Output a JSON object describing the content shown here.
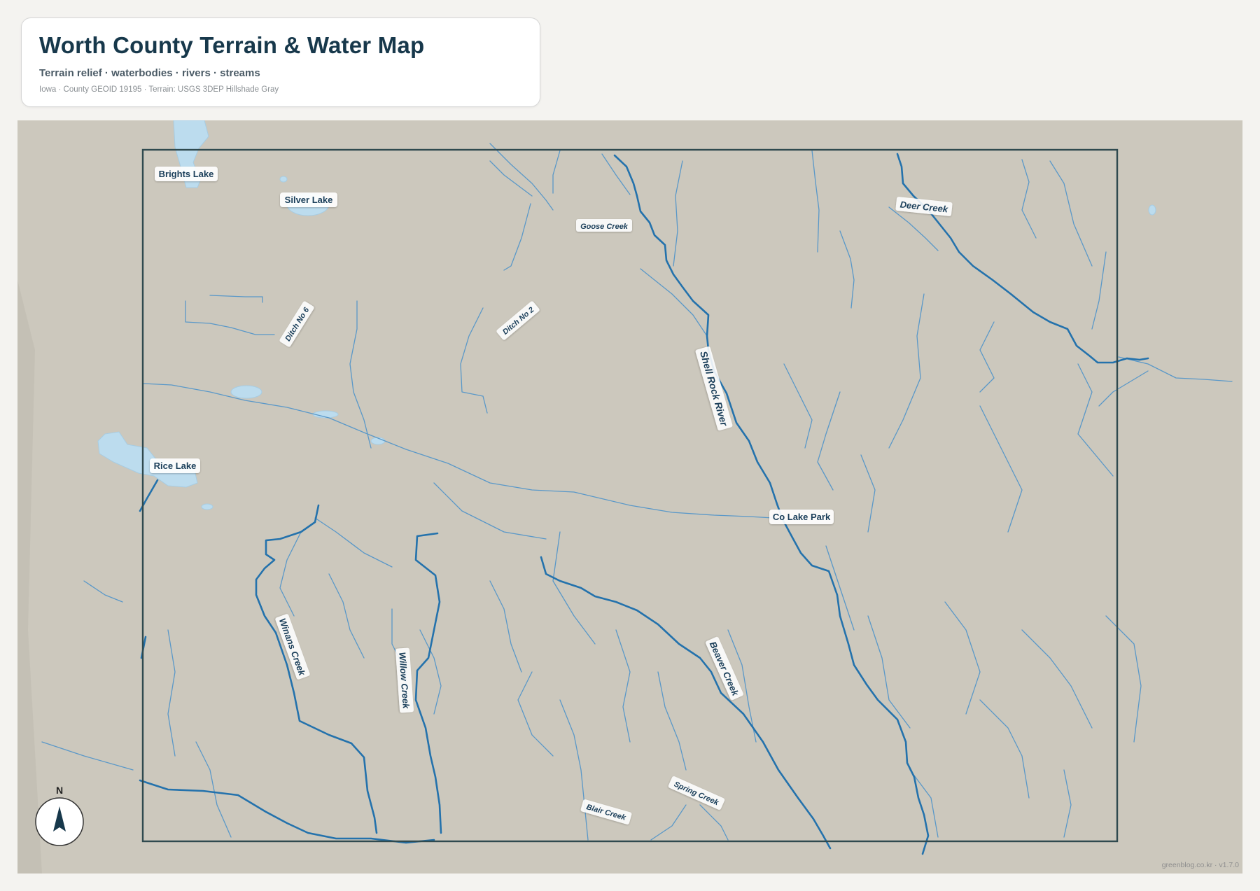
{
  "header": {
    "title": "Worth County Terrain & Water Map",
    "subtitle": "Terrain relief · waterbodies · rivers · streams",
    "meta": "Iowa · County GEOID 19195 · Terrain: USGS 3DEP Hillshade Gray"
  },
  "map": {
    "labels": {
      "brights_lake": "Brights Lake",
      "silver_lake": "Silver Lake",
      "rice_lake": "Rice Lake",
      "co_lake_park": "Co Lake Park",
      "goose_creek": "Goose Creek",
      "deer_creek": "Deer Creek",
      "ditch_no_6": "Ditch No 6",
      "ditch_no_2": "Ditch No 2",
      "shell_rock_river": "Shell Rock River",
      "winans_creek": "Winans Creek",
      "willow_creek": "Willow Creek",
      "beaver_creek": "Beaver Creek",
      "spring_creek": "Spring Creek",
      "blair_creek": "Blair Creek"
    },
    "north_arrow": "N",
    "colors": {
      "terrain": "#ccc8bd",
      "water": "#bcdcee",
      "river": "#2472ac",
      "stream": "#5a98c8",
      "boundary": "#2f4a4f"
    }
  },
  "footer": {
    "credit": "greenblog.co.kr · v1.7.0"
  }
}
